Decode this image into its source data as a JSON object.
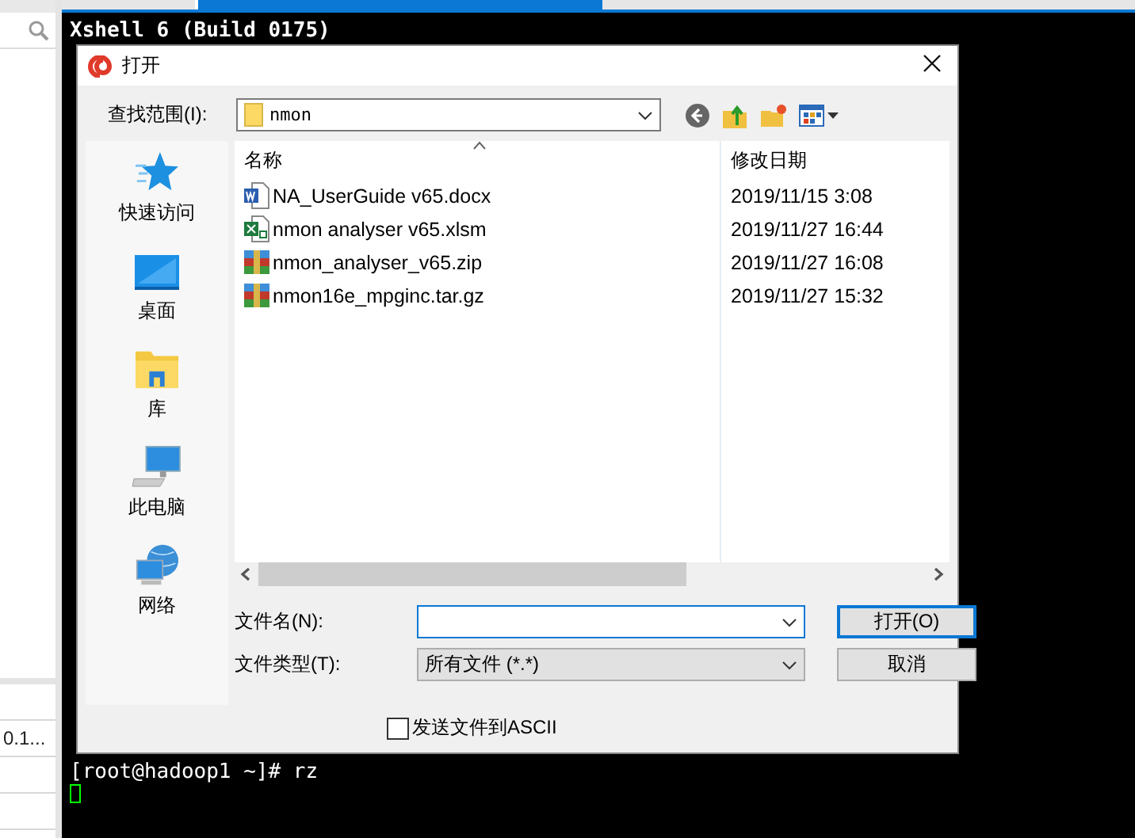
{
  "background_window": {
    "cell_text": "0.1..."
  },
  "terminal": {
    "title": "Xshell 6 (Build 0175)",
    "prompt": "[root@hadoop1 ~]# rz"
  },
  "dialog": {
    "title": "打开",
    "look_in": {
      "label": "查找范围(I):",
      "value": "nmon"
    },
    "places": [
      {
        "label": "快速访问",
        "kind": "star"
      },
      {
        "label": "桌面",
        "kind": "desktop"
      },
      {
        "label": "库",
        "kind": "library"
      },
      {
        "label": "此电脑",
        "kind": "computer"
      },
      {
        "label": "网络",
        "kind": "network"
      }
    ],
    "columns": [
      "名称",
      "修改日期"
    ],
    "files": [
      {
        "name": "NA_UserGuide v65.docx",
        "kind": "word",
        "modified": "2019/11/15 3:08"
      },
      {
        "name": "nmon analyser v65.xlsm",
        "kind": "excel",
        "modified": "2019/11/27 16:44"
      },
      {
        "name": "nmon_analyser_v65.zip",
        "kind": "archive",
        "modified": "2019/11/27 16:08"
      },
      {
        "name": "nmon16e_mpginc.tar.gz",
        "kind": "archive",
        "modified": "2019/11/27 15:32"
      }
    ],
    "file_name": {
      "label": "文件名(N):"
    },
    "file_type": {
      "label": "文件类型(T):",
      "value": "所有文件 (*.*)"
    },
    "buttons": [
      {
        "label": "打开(O)",
        "default": true
      },
      {
        "label": "取消",
        "default": false
      }
    ],
    "ascii": {
      "label": "发送文件到ASCII",
      "checked": false
    }
  }
}
